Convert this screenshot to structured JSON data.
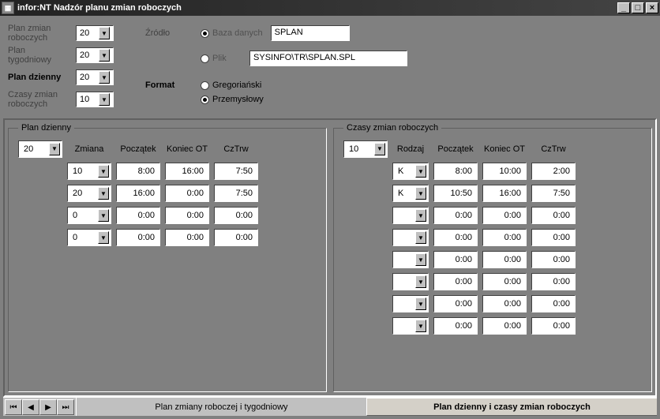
{
  "window": {
    "title": "infor:NT Nadzór planu zmian roboczych"
  },
  "top": {
    "plan_zmian_roboczych_label": "Plan zmian roboczych",
    "plan_zmian_roboczych_value": "20",
    "plan_tygodniowy_label": "Plan tygodniowy",
    "plan_tygodniowy_value": "20",
    "plan_dzienny_label": "Plan dzienny",
    "plan_dzienny_value": "20",
    "czasy_zmian_label": "Czasy zmian roboczych",
    "czasy_zmian_value": "10",
    "zrodlo_label": "Źródło",
    "baza_label": "Baza danych",
    "baza_value": "SPLAN",
    "plik_label": "Plik",
    "plik_value": "SYSINFO\\TR\\SPLAN.SPL",
    "format_label": "Format",
    "format_opt1": "Gregoriański",
    "format_opt2": "Przemysłowy"
  },
  "panelLeft": {
    "legend": "Plan dzienny",
    "selector": "20",
    "headers": {
      "zmiana": "Zmiana",
      "poczatek": "Początek",
      "koniec": "Koniec OT",
      "cztrw": "CzTrw"
    },
    "rows": [
      {
        "zmiana": "10",
        "poczatek": "8:00",
        "koniec": "16:00",
        "cztrw": "7:50"
      },
      {
        "zmiana": "20",
        "poczatek": "16:00",
        "koniec": "0:00",
        "cztrw": "7:50"
      },
      {
        "zmiana": "0",
        "poczatek": "0:00",
        "koniec": "0:00",
        "cztrw": "0:00"
      },
      {
        "zmiana": "0",
        "poczatek": "0:00",
        "koniec": "0:00",
        "cztrw": "0:00"
      }
    ]
  },
  "panelRight": {
    "legend": "Czasy zmian roboczych",
    "selector": "10",
    "headers": {
      "rodzaj": "Rodzaj",
      "poczatek": "Początek",
      "koniec": "Koniec OT",
      "cztrw": "CzTrw"
    },
    "rows": [
      {
        "rodzaj": "K",
        "poczatek": "8:00",
        "koniec": "10:00",
        "cztrw": "2:00"
      },
      {
        "rodzaj": "K",
        "poczatek": "10:50",
        "koniec": "16:00",
        "cztrw": "7:50"
      },
      {
        "rodzaj": "",
        "poczatek": "0:00",
        "koniec": "0:00",
        "cztrw": "0:00"
      },
      {
        "rodzaj": "",
        "poczatek": "0:00",
        "koniec": "0:00",
        "cztrw": "0:00"
      },
      {
        "rodzaj": "",
        "poczatek": "0:00",
        "koniec": "0:00",
        "cztrw": "0:00"
      },
      {
        "rodzaj": "",
        "poczatek": "0:00",
        "koniec": "0:00",
        "cztrw": "0:00"
      },
      {
        "rodzaj": "",
        "poczatek": "0:00",
        "koniec": "0:00",
        "cztrw": "0:00"
      },
      {
        "rodzaj": "",
        "poczatek": "0:00",
        "koniec": "0:00",
        "cztrw": "0:00"
      }
    ]
  },
  "tabs": {
    "tab1": "Plan zmiany roboczej i tygodniowy",
    "tab2": "Plan dzienny i czasy zmian roboczych"
  }
}
